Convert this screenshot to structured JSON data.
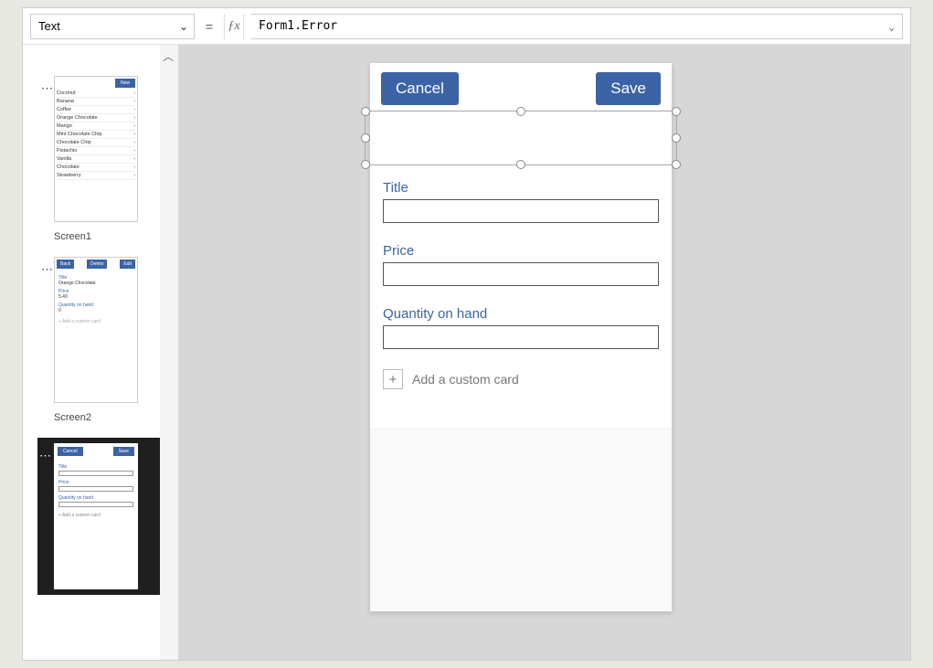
{
  "formulaBar": {
    "property": "Text",
    "formula": "Form1.Error"
  },
  "thumbnails": {
    "screen1": {
      "label": "Screen1",
      "newBtn": "New",
      "items": [
        "Coconut",
        "Banana",
        "Coffee",
        "Orange Chocolate",
        "Mango",
        "Mint Chocolate Chip",
        "Chocolate Chip",
        "Pistachio",
        "Vanilla",
        "Chocolate",
        "Strawberry"
      ]
    },
    "screen2": {
      "label": "Screen2",
      "buttons": {
        "back": "Back",
        "delete": "Delete",
        "edit": "Edit"
      },
      "fields": {
        "titleLabel": "Title",
        "titleValue": "Orange Chocolate",
        "priceLabel": "Price",
        "priceValue": "5.49",
        "qtyLabel": "Quantity on hand",
        "qtyValue": "0",
        "addCard": "+  Add a custom card"
      }
    },
    "screen3": {
      "buttons": {
        "cancel": "Cancel",
        "save": "Save"
      },
      "fields": {
        "titleLabel": "Title",
        "priceLabel": "Price",
        "qtyLabel": "Quantity on hand",
        "addCard": "+  Add a custom card"
      }
    }
  },
  "preview": {
    "cancel": "Cancel",
    "save": "Save",
    "fields": {
      "title": "Title",
      "price": "Price",
      "qty": "Quantity on hand"
    },
    "addCard": "Add a custom card"
  }
}
